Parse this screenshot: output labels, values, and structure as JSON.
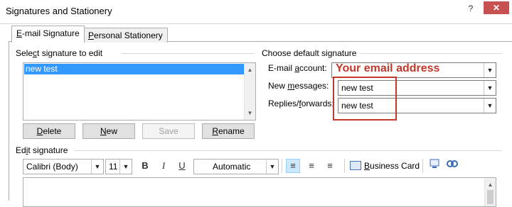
{
  "window": {
    "title": "Signatures and Stationery",
    "help_glyph": "?",
    "close_glyph": "✕"
  },
  "tabs": [
    {
      "label_underline": "E",
      "label_rest": "-mail Signature"
    },
    {
      "label_underline": "P",
      "label_rest": "ersonal Stationery"
    }
  ],
  "select_section": {
    "label_pre": "Sele",
    "label_underline": "c",
    "label_post": "t signature to edit",
    "items": [
      "new test"
    ]
  },
  "buttons": {
    "delete": {
      "u": "D",
      "rest": "elete"
    },
    "new": {
      "u": "N",
      "rest": "ew"
    },
    "save": "Save",
    "rename": {
      "u": "R",
      "rest": "ename"
    }
  },
  "default_section": {
    "label": "Choose default signature",
    "email_account_label_pre": "E-mail ",
    "email_account_label_underline": "a",
    "email_account_label_post": "ccount:",
    "email_account_value": "",
    "new_messages_label_pre": "New ",
    "new_messages_label_underline": "m",
    "new_messages_label_post": "essages:",
    "new_messages_value": "new test",
    "replies_label_pre": "Replies/",
    "replies_label_underline": "f",
    "replies_label_post": "orwards:",
    "replies_value": "new test"
  },
  "annotation": {
    "callout": "Your email address",
    "color": "#c0392b"
  },
  "edit_section": {
    "label_pre": "Ed",
    "label_underline": "i",
    "label_post": "t signature",
    "font": "Calibri (Body)",
    "size": "11",
    "bold": "B",
    "italic": "I",
    "underline": "U",
    "color": "Automatic",
    "business_card_u": "B",
    "business_card_rest": "usiness Card"
  },
  "colors": {
    "selection": "#3399ff",
    "close_button": "#c75050"
  }
}
